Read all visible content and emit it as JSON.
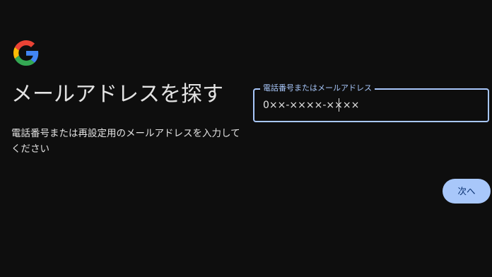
{
  "brand": {
    "logo_icon": "google-g-icon",
    "colors": {
      "blue": "#4285F4",
      "red": "#EA4335",
      "yellow": "#FBBC05",
      "green": "#34A853"
    }
  },
  "page": {
    "title": "メールアドレスを探す",
    "subtitle": "電話番号または再設定用のメールアドレスを入力してください"
  },
  "form": {
    "field_label": "電話番号またはメールアドレス",
    "field_value": "0××-××××-××××",
    "next_label": "次へ"
  },
  "theme": {
    "background": "#0e0e0e",
    "accent": "#a8c7fa",
    "text": "#e3e3e3"
  }
}
